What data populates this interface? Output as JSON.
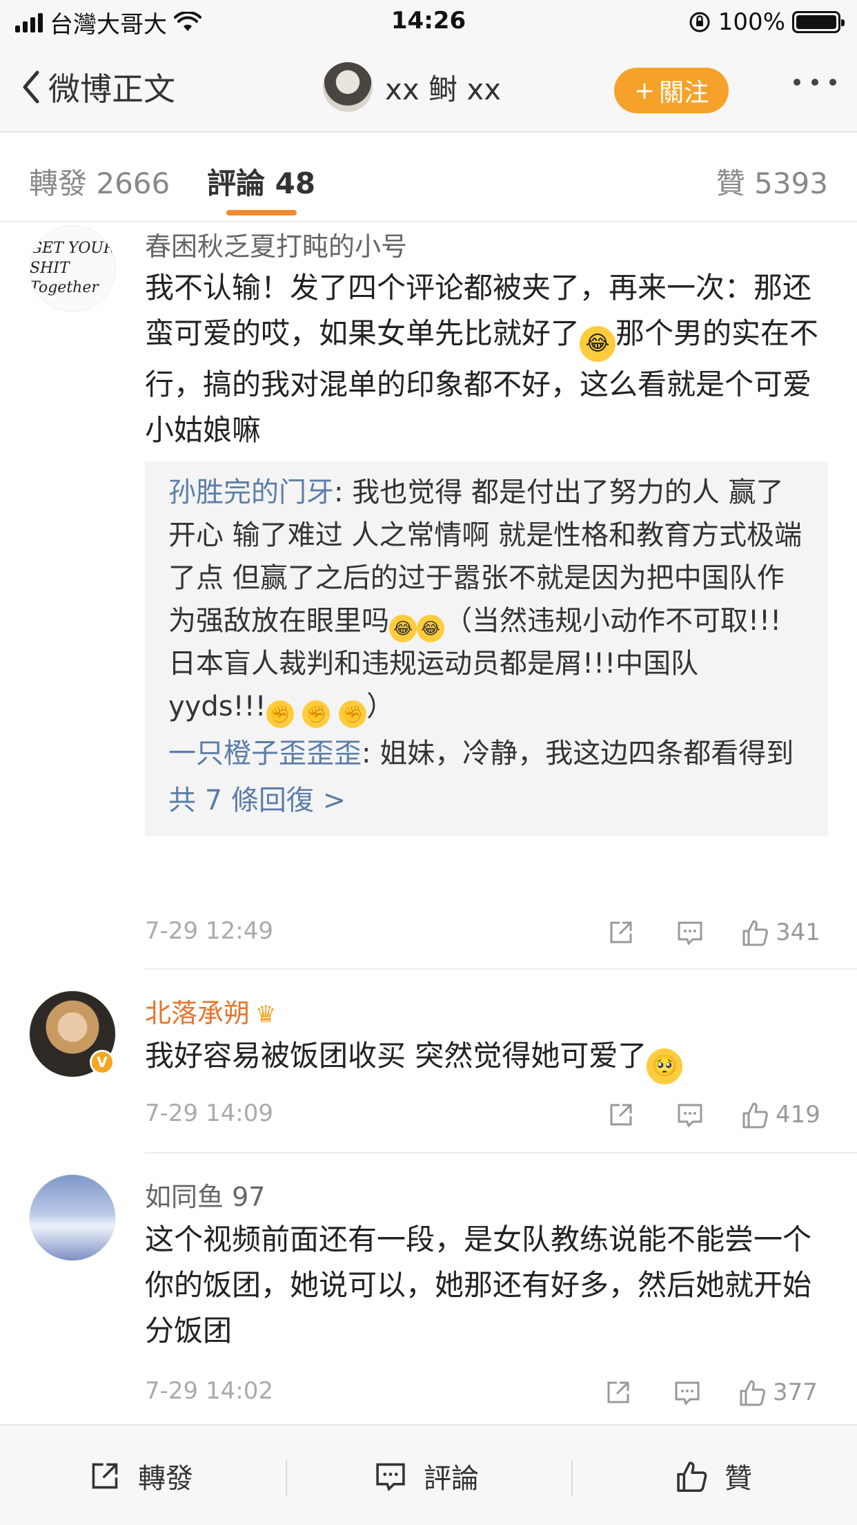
{
  "status_bar": {
    "carrier": "台灣大哥大",
    "time": "14:26",
    "battery": "100%"
  },
  "nav": {
    "back_label": "微博正文",
    "user_name": "xx 鲥 xx",
    "follow_label": "關注",
    "follow_plus": "+"
  },
  "tabs": {
    "repost": "轉發 2666",
    "comments": "評論 48",
    "likes": "贊 5393"
  },
  "comments": [
    {
      "user": "春困秋乏夏打盹的小号",
      "avatar_text_1": "GET YOUR",
      "avatar_text_2": "SHIT Together",
      "text_before_emoji": "我不认输！发了四个评论都被夹了，再来一次：那还蛮可爱的哎，如果女单先比就好了",
      "emoji": "laugh-cry",
      "text_after_emoji": "那个男的实在不行，搞的我对混单的印象都不好，这么看就是个可爱小姑娘嘛",
      "replies": [
        {
          "name": "孙胜完的门牙",
          "text_1": ": 我也觉得 都是付出了努力的人 赢了开心 输了难过 人之常情啊 就是性格和教育方式极端了点 但赢了之后的过于嚣张不就是因为把中国队作为强敌放在眼里吗",
          "text_2": "（当然违规小动作不可取!!!日本盲人裁判和违规运动员都是屑!!!中国队 yyds!!!",
          "text_3": "）"
        },
        {
          "name": "一只橙子歪歪歪",
          "text_1": ": 姐妹，冷静，我这边四条都看得到"
        }
      ],
      "more_replies": "共 7 條回復 >",
      "time": "7-29 12:49",
      "likes": "341"
    },
    {
      "user": "北落承朔",
      "avatar_badge": "V",
      "text": "我好容易被饭团收买  突然觉得她可爱了",
      "emoji": "pleading",
      "time": "7-29 14:09",
      "likes": "419"
    },
    {
      "user": "如同鱼 97",
      "text": "这个视频前面还有一段，是女队教练说能不能尝一个你的饭团，她说可以，她那还有好多，然后她就开始分饭团",
      "time": "7-29 14:02",
      "likes": "377"
    }
  ],
  "bottom_bar": {
    "repost": "轉發",
    "comment": "評論",
    "like": "贊"
  },
  "colors": {
    "accent": "#f6a22a",
    "link": "#5b7ea8",
    "vip_name": "#e8742a"
  }
}
